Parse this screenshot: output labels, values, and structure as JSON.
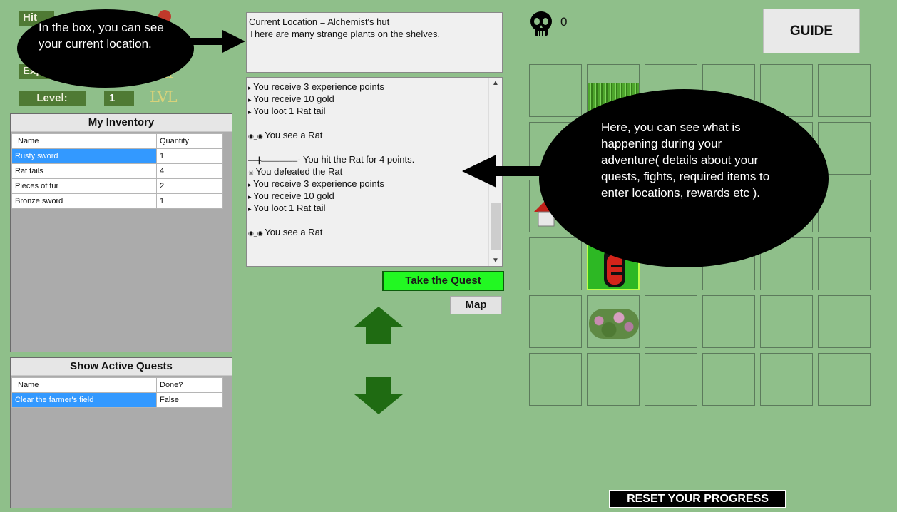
{
  "player": {
    "level_label": "Level:",
    "level_value": "1",
    "level_unit": "LVL",
    "hp_label_partial": "Hit",
    "exp_label_partial": "Exp"
  },
  "inventory": {
    "title": "My Inventory",
    "columns": [
      "Name",
      "Quantity"
    ],
    "rows": [
      {
        "name": "Rusty sword",
        "qty": "1"
      },
      {
        "name": "Rat tails",
        "qty": "4"
      },
      {
        "name": "Pieces of fur",
        "qty": "2"
      },
      {
        "name": "Bronze sword",
        "qty": "1"
      }
    ]
  },
  "quests": {
    "title": "Show Active Quests",
    "columns": [
      "Name",
      "Done?"
    ],
    "rows": [
      {
        "name": "Clear the farmer's field",
        "done": "False"
      }
    ]
  },
  "location": {
    "line1": "Current Location = Alchemist's hut",
    "line2": "There are many strange plants on the shelves."
  },
  "log": {
    "lines": [
      "You receive 3 experience points",
      "You receive 10 gold",
      "You loot 1 Rat tail",
      "",
      "You see a Rat",
      "",
      "- You hit the Rat for 4 points.",
      "You defeated the Rat",
      "You receive 3 experience points",
      "You receive 10 gold",
      "You loot 1 Rat tail",
      "",
      "You see a Rat"
    ]
  },
  "buttons": {
    "take_quest": "Take the Quest",
    "map": "Map",
    "guide": "GUIDE",
    "reset": "RESET YOUR PROGRESS"
  },
  "kills": {
    "icon": "skull-icon",
    "count": "0"
  },
  "tutorial": {
    "location_tip": "In the box, you can see your current location.",
    "log_tip": "Here, you can see what is happening during your adventure( details about your quests, fights, required items to enter locations, rewards etc )."
  },
  "colors": {
    "background": "#8fbf8a",
    "quest_button": "#22f822",
    "nav_arrow": "#1f6b12",
    "selection": "#3399ff"
  }
}
